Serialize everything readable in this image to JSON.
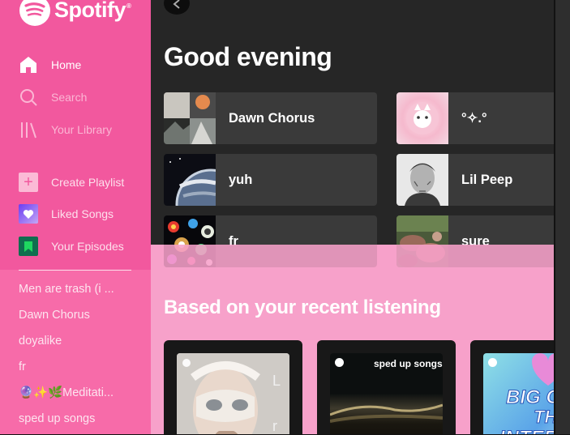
{
  "app": {
    "brand": "Spotify",
    "brand_mark": "®",
    "accent": "#f2589e"
  },
  "sidebar": {
    "nav": [
      {
        "label": "Home",
        "icon": "home-icon"
      },
      {
        "label": "Search",
        "icon": "search-icon"
      },
      {
        "label": "Your Library",
        "icon": "library-icon"
      }
    ],
    "actions": [
      {
        "label": "Create Playlist",
        "icon": "plus-icon"
      },
      {
        "label": "Liked Songs",
        "icon": "heart-icon"
      },
      {
        "label": "Your Episodes",
        "icon": "bookmark-icon"
      }
    ],
    "playlists": [
      "Men are trash (i ...",
      "Dawn Chorus",
      "doyalike",
      "fr",
      "🔮✨🌿Meditati...",
      "sped up songs"
    ]
  },
  "main": {
    "greeting": "Good evening",
    "quick_picks": [
      {
        "title": "Dawn Chorus"
      },
      {
        "title": "°✧.°"
      },
      {
        "title": "yuh"
      },
      {
        "title": "Lil Peep"
      },
      {
        "title": "fr"
      },
      {
        "title": "sure"
      }
    ],
    "section_title": "Based on your recent listening",
    "cards": [
      {
        "caption": ""
      },
      {
        "caption": "sped up songs"
      },
      {
        "caption": ""
      }
    ]
  }
}
